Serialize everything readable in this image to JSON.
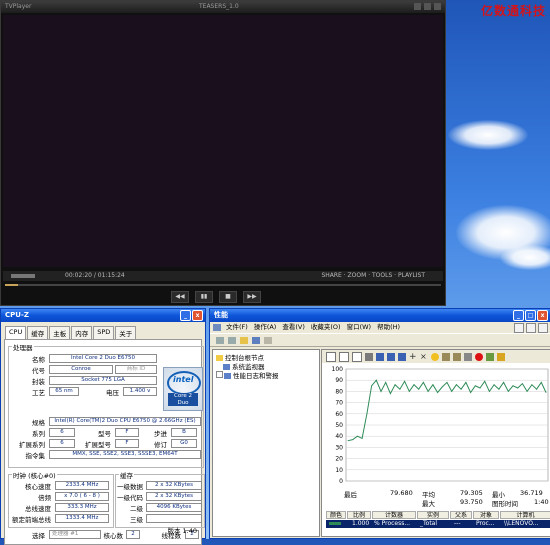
{
  "desktop": {
    "watermark": "亿数通科技"
  },
  "player": {
    "title": "TVPlayer",
    "file": "TEASERS_1.0",
    "time": "00:02:20 / 01:15:24",
    "info_right": "SHARE · ZOOM · TOOLS · PLAYLIST",
    "seek_fraction": 0.03
  },
  "cpuz": {
    "title": "CPU-Z",
    "tabs": [
      "CPU",
      "缓存",
      "主板",
      "内存",
      "SPD",
      "关于"
    ],
    "processor_group": "处理器",
    "labels": {
      "name": "名称",
      "codename": "代号",
      "package": "封装",
      "tech": "工艺",
      "voltage": "电压",
      "spec": "规格",
      "family": "系列",
      "model": "型号",
      "stepping": "步进",
      "ext_family": "扩展系列",
      "ext_model": "扩展型号",
      "revision": "修订",
      "instructions": "指令集"
    },
    "values": {
      "name": "Intel Core 2 Duo E6750",
      "codename": "Conroe",
      "brand_id": "商标 ID",
      "package": "Socket 775 LGA",
      "tech": "65 nm",
      "voltage": "1.400 v",
      "spec": "Intel(R) Core(TM)2 Duo CPU  E6750 @ 2.66GHz (ES)",
      "family": "6",
      "model": "F",
      "stepping": "B",
      "ext_family": "6",
      "ext_model": "F",
      "revision": "G0",
      "instructions": "MMX, SSE, SSE2, SSE3, SSSE3, EM64T"
    },
    "clocks": {
      "group": "时钟 (核心#0)",
      "core_speed_label": "核心速度",
      "core_speed": "2333.4 MHz",
      "multiplier_label": "倍频",
      "multiplier": "x 7.0 ( 6 - 8 )",
      "bus_speed_label": "总线速度",
      "bus_speed": "333.3 MHz",
      "rated_fsb_label": "额定前端总线",
      "rated_fsb": "1333.4 MHz"
    },
    "cache": {
      "group": "缓存",
      "l1d_label": "一级数据",
      "l1d": "2 x 32 KBytes",
      "l1i_label": "一级代码",
      "l1i": "2 x 32 KBytes",
      "l2_label": "二级",
      "l2": "4096 KBytes",
      "l3_label": "三级",
      "l3": ""
    },
    "bottom": {
      "select_label": "选择",
      "select_value": "处理器 #1",
      "cores_label": "核心数",
      "cores": "2",
      "threads_label": "线程数",
      "threads": "2",
      "version": "版本 1.40"
    },
    "intel_logo": {
      "brand": "intel",
      "product": "Core 2 Duo"
    }
  },
  "perf": {
    "title": "性能",
    "menu": [
      "文件(F)",
      "操作(A)",
      "查看(V)",
      "收藏夹(O)",
      "窗口(W)",
      "帮助(H)"
    ],
    "tree": {
      "root": "控制台根节点",
      "child1": "系统监视器",
      "child2": "性能日志和警报"
    },
    "y_ticks": [
      "100",
      "90",
      "80",
      "70",
      "60",
      "50",
      "40",
      "30",
      "20",
      "10",
      "0"
    ],
    "stats": {
      "last_label": "最后",
      "last": "79.680",
      "avg_label": "平均",
      "avg": "79.305",
      "min_label": "最小",
      "min": "36.719",
      "max_label": "最大",
      "max": "93.750",
      "duration_label": "图形时间",
      "duration": "1:40"
    },
    "legend_headers": [
      "颜色",
      "比例",
      "计数器",
      "实例",
      "父系",
      "对象",
      "计算机"
    ],
    "legend_row": {
      "scale": "1.000",
      "counter": "% Process...",
      "instance": "_Total",
      "parent": "---",
      "object": "Proc...",
      "computer": "\\\\LENOVO..."
    }
  },
  "chart_data": {
    "type": "line",
    "title": "",
    "xlabel": "",
    "ylabel": "",
    "ylim": [
      0,
      100
    ],
    "grid": true,
    "series": [
      {
        "values": [
          36,
          37,
          40,
          38,
          60,
          85,
          90,
          80,
          88,
          78,
          86,
          82,
          89,
          80,
          86,
          82,
          88,
          80,
          86,
          79,
          84,
          88,
          80,
          86,
          82,
          88,
          79,
          85,
          83,
          89,
          80,
          86,
          82,
          88,
          80,
          85,
          83,
          87,
          80,
          86,
          82,
          88,
          79
        ]
      }
    ]
  }
}
